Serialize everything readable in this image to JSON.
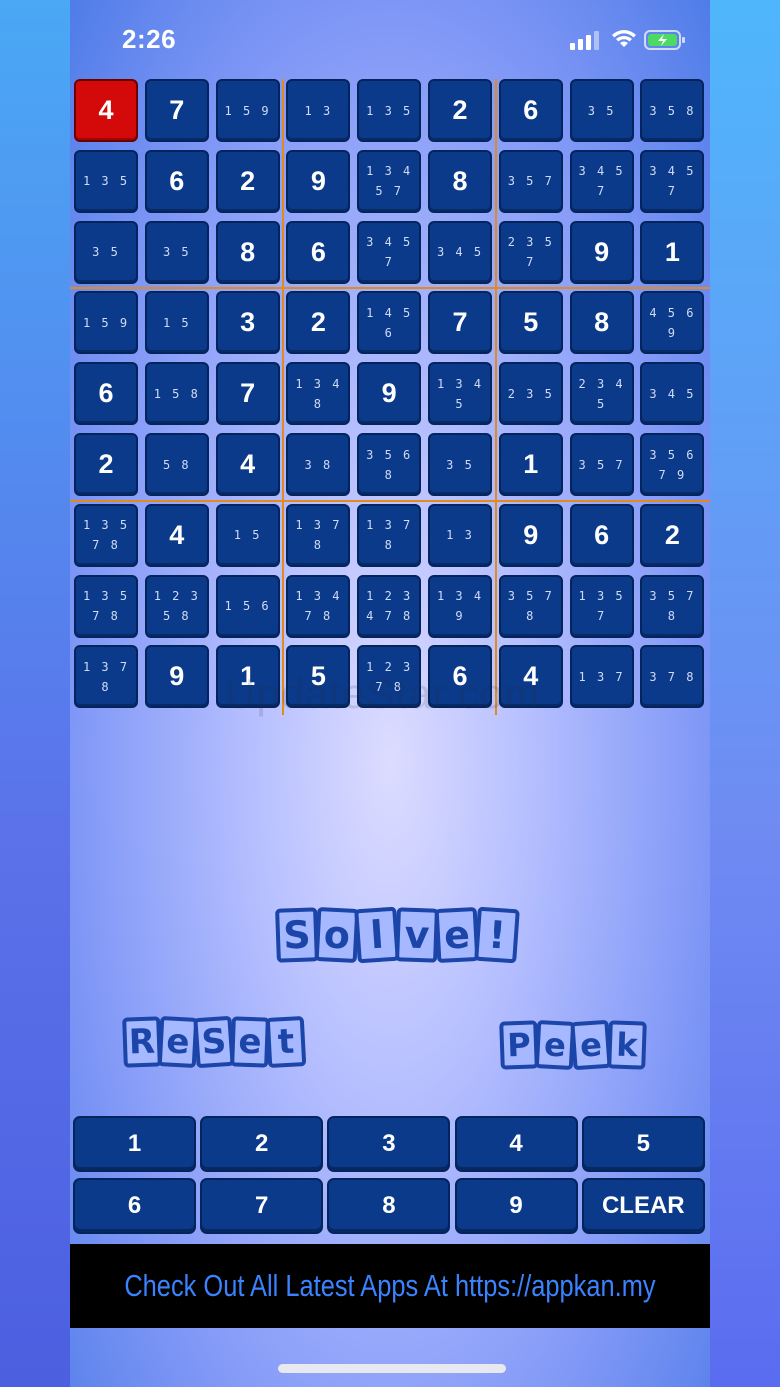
{
  "status_bar": {
    "time": "2:26"
  },
  "board": {
    "selected": [
      0,
      0
    ],
    "cells": [
      [
        "4",
        "7",
        "1 5 9",
        "1 3",
        "1 3 5",
        "2",
        "6",
        "3 5",
        "3 5 8"
      ],
      [
        "1 3 5",
        "6",
        "2",
        "9",
        "1 3 4\n5 7",
        "8",
        "3 5 7",
        "3 4 5\n7",
        "3 4 5\n7"
      ],
      [
        "3 5",
        "3 5",
        "8",
        "6",
        "3 4 5\n7",
        "3 4 5",
        "2 3 5\n7",
        "9",
        "1"
      ],
      [
        "1 5 9",
        "1 5",
        "3",
        "2",
        "1 4 5\n6",
        "7",
        "5",
        "8",
        "4 5 6\n9"
      ],
      [
        "6",
        "1 5 8",
        "7",
        "1 3 4\n8",
        "9",
        "1 3 4\n5",
        "2 3 5",
        "2 3 4\n5",
        "3 4 5"
      ],
      [
        "2",
        "5 8",
        "4",
        "3 8",
        "3 5 6\n8",
        "3 5",
        "1",
        "3 5 7",
        "3 5 6\n7 9"
      ],
      [
        "1 3 5\n7 8",
        "4",
        "1 5",
        "1 3 7\n8",
        "1 3 7\n8",
        "1 3",
        "9",
        "6",
        "2"
      ],
      [
        "1 3 5\n7 8",
        "1 2 3\n5 8",
        "1 5 6",
        "1 3 4\n7 8",
        "1 2 3\n4 7 8",
        "1 3 4\n9",
        "3 5 7\n8",
        "1 3 5\n7",
        "3 5 7\n8"
      ],
      [
        "1 3 7\n8",
        "9",
        "1",
        "5",
        "1 2 3\n7 8",
        "6",
        "4",
        "1 3 7",
        "3 7 8"
      ]
    ]
  },
  "watermark": "UpdateStar.com",
  "buttons": {
    "solve": [
      "S",
      "o",
      "l",
      "v",
      "e",
      "!"
    ],
    "reset": [
      "R",
      "e",
      "S",
      "e",
      "t"
    ],
    "peek": [
      "P",
      "e",
      "e",
      "k"
    ]
  },
  "keypad": [
    "1",
    "2",
    "3",
    "4",
    "5",
    "6",
    "7",
    "8",
    "9",
    "CLEAR"
  ],
  "banner": "Check Out All Latest Apps At https://appkan.my",
  "colors": {
    "cell": "#0b3a8a",
    "selected": "#d40a0a",
    "gridline": "#e38a1d",
    "banner_text": "#3b82ff"
  }
}
